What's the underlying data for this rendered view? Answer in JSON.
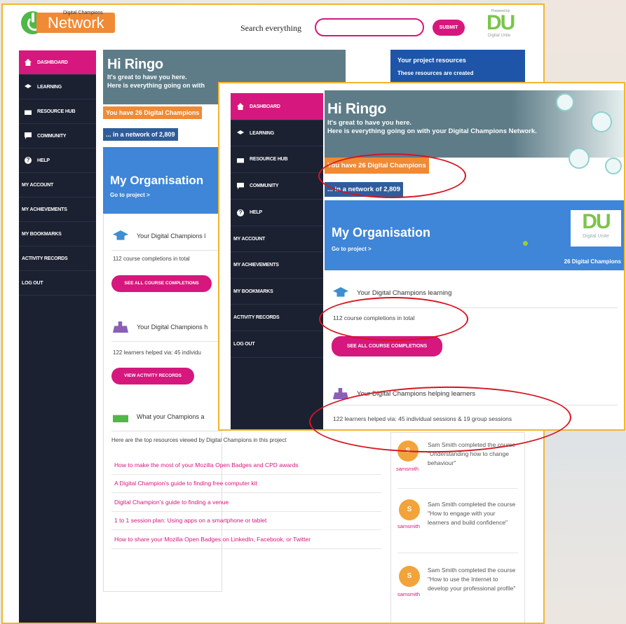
{
  "brand": {
    "logo_small": "Digital Champions",
    "logo_word": "Network",
    "partner_powered": "Powered by",
    "partner_letters": "DU",
    "partner_caption": "Digital Unite"
  },
  "search": {
    "label": "Search everything",
    "placeholder": "",
    "submit": "SUBMIT"
  },
  "sidebar": {
    "items": [
      {
        "label": "DASHBOARD",
        "icon": "home-icon"
      },
      {
        "label": "LEARNING",
        "icon": "graduation-cap-icon"
      },
      {
        "label": "RESOURCE HUB",
        "icon": "resource-hub-icon"
      },
      {
        "label": "COMMUNITY",
        "icon": "chat-icon"
      },
      {
        "label": "HELP",
        "icon": "help-icon"
      },
      {
        "label": "MY ACCOUNT"
      },
      {
        "label": "MY ACHIEVEMENTS"
      },
      {
        "label": "MY BOOKMARKS"
      },
      {
        "label": "ACTIVITY RECORDS"
      },
      {
        "label": "LOG OUT"
      }
    ]
  },
  "welcome": {
    "greeting": "Hi Ringo",
    "line1": "It's great to have you here.",
    "line2_short": "Here is everything going on with",
    "line2_full": "Here is everything going on with your Digital Champions Network.",
    "champions_count": "You have 26 Digital Champions",
    "network_size": "... in a network of 2,809"
  },
  "org": {
    "title": "My Organisation",
    "go": "Go to project >",
    "badge_letters": "DU",
    "badge_caption": "Digital Unite",
    "champions_label": "26 Digital Champions"
  },
  "learning": {
    "heading_short": "Your Digital Champions l",
    "heading": "Your Digital Champions learning",
    "completions": "112 course completions in total",
    "button": "SEE ALL COURSE COMPLETIONS"
  },
  "helping": {
    "heading_short": "Your Digital Champions h",
    "heading": "Your Digital Champions helping learners",
    "summary_short": "122 learners helped via: 45 individu",
    "summary": "122 learners helped via: 45 individual sessions & 19 group sessions",
    "button": "VIEW ACTIVITY RECORDS"
  },
  "resources": {
    "heading": "What your Champions a",
    "intro": "Here are the top resources viewed by Digital Champions in this project",
    "links": [
      "How to make the most of your Mozilla Open Badges and CPD awards",
      "A Digital Champion's guide to finding free computer kit",
      "Digital Champion's guide to finding a venue",
      "1 to 1 session plan: Using apps on a smartphone or tablet",
      "How to share your Mozilla Open Badges on LinkedIn, Facebook, or Twitter"
    ]
  },
  "project_resources": {
    "title": "Your project resources",
    "text": "These resources are created"
  },
  "activity": [
    {
      "avatar": "S",
      "user": "samsmith",
      "text": "Sam Smith completed the course \"Understanding how to change behaviour\""
    },
    {
      "avatar": "S",
      "user": "samsmith",
      "text": "Sam Smith completed the course \"How to engage with your learners and build confidence\""
    },
    {
      "avatar": "S",
      "user": "samsmith",
      "text": "Sam Smith completed the course \"How to use the Internet to develop your professional profile\""
    }
  ],
  "colors": {
    "pink": "#d6177d",
    "orange": "#f08a35",
    "navy": "#1c2132",
    "blue": "#3f85d8",
    "slate": "#5d7c88",
    "highlight": "#d71420",
    "frame": "#f2b531"
  }
}
